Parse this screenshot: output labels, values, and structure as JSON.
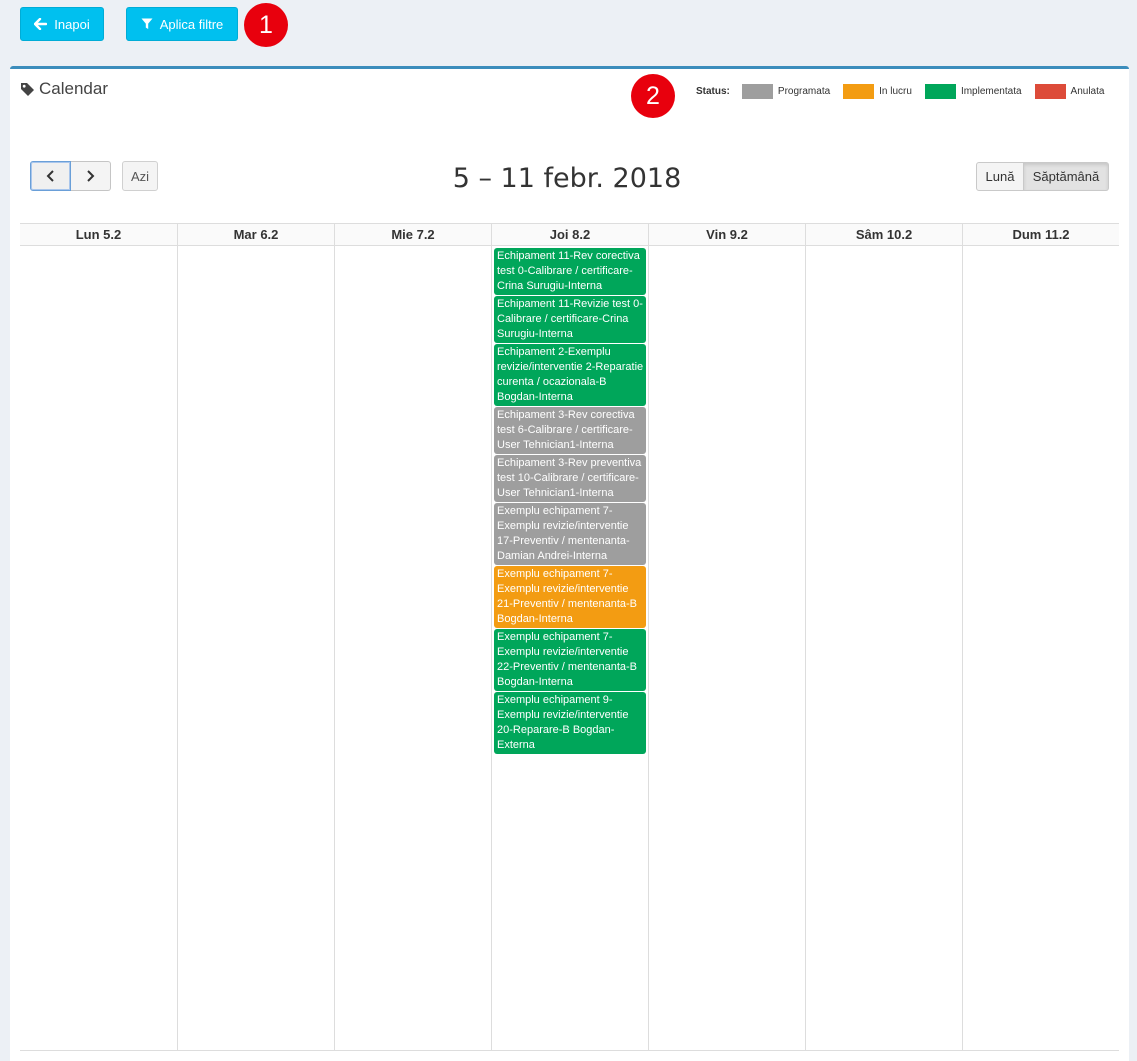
{
  "toolbar": {
    "back_label": "Inapoi",
    "filter_label": "Aplica filtre",
    "marker_1": "1",
    "marker_2": "2"
  },
  "box": {
    "title": "Calendar"
  },
  "legend": {
    "title": "Status:",
    "items": [
      {
        "label": "Programata",
        "color": "#9e9e9e"
      },
      {
        "label": "In lucru",
        "color": "#f39c12"
      },
      {
        "label": "Implementata",
        "color": "#00a65a"
      },
      {
        "label": "Anulata",
        "color": "#dd4b39"
      }
    ]
  },
  "calendar": {
    "today_label": "Azi",
    "title": "5 – 11 febr. 2018",
    "view_month": "Lună",
    "view_week": "Săptămână",
    "days": [
      "Lun 5.2",
      "Mar 6.2",
      "Mie 7.2",
      "Joi 8.2",
      "Vin 9.2",
      "Sâm 10.2",
      "Dum 11.2"
    ],
    "events": [
      {
        "day": 3,
        "status": "Implementata",
        "color": "#00a65a",
        "text": "Echipament 11-Rev corectiva test 0-Calibrare / certificare-Crina Surugiu-Interna"
      },
      {
        "day": 3,
        "status": "Implementata",
        "color": "#00a65a",
        "text": "Echipament 11-Revizie test 0-Calibrare / certificare-Crina Surugiu-Interna"
      },
      {
        "day": 3,
        "status": "Implementata",
        "color": "#00a65a",
        "text": "Echipament 2-Exemplu revizie/interventie 2-Reparatie curenta / ocazionala-B Bogdan-Interna"
      },
      {
        "day": 3,
        "status": "Programata",
        "color": "#9e9e9e",
        "text": "Echipament 3-Rev corectiva test 6-Calibrare / certificare-User Tehnician1-Interna"
      },
      {
        "day": 3,
        "status": "Programata",
        "color": "#9e9e9e",
        "text": "Echipament 3-Rev preventiva test 10-Calibrare / certificare-User Tehnician1-Interna"
      },
      {
        "day": 3,
        "status": "Programata",
        "color": "#9e9e9e",
        "text": "Exemplu echipament 7-Exemplu revizie/interventie 17-Preventiv / mentenanta-Damian Andrei-Interna"
      },
      {
        "day": 3,
        "status": "In lucru",
        "color": "#f39c12",
        "text": "Exemplu echipament 7-Exemplu revizie/interventie 21-Preventiv / mentenanta-B Bogdan-Interna"
      },
      {
        "day": 3,
        "status": "Implementata",
        "color": "#00a65a",
        "text": "Exemplu echipament 7-Exemplu revizie/interventie 22-Preventiv / mentenanta-B Bogdan-Interna"
      },
      {
        "day": 3,
        "status": "Implementata",
        "color": "#00a65a",
        "text": "Exemplu echipament 9-Exemplu revizie/interventie 20-Reparare-B Bogdan-Externa"
      }
    ]
  }
}
